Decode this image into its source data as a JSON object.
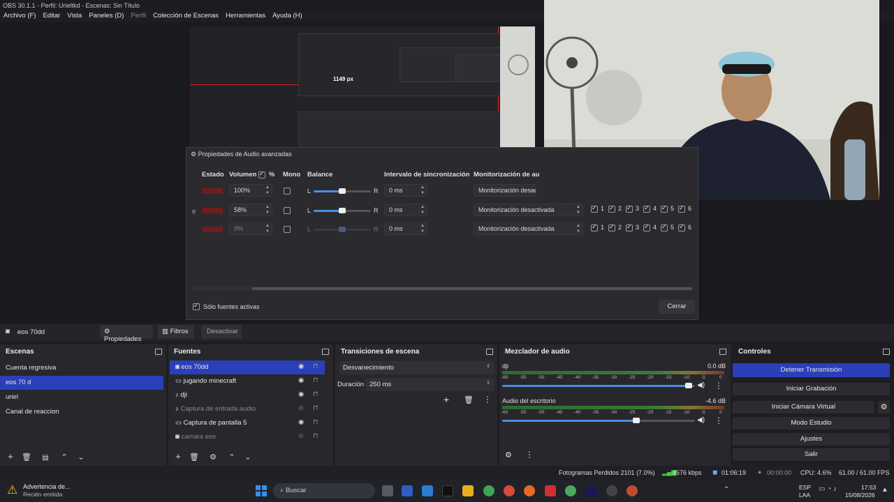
{
  "window": {
    "title": "OBS 30.1.1 - Perfil: Urieltkd - Escenas: Sin Título"
  },
  "menu": [
    "Archivo (F)",
    "Editar",
    "Vista",
    "Paneles (D)",
    "Perfil",
    "Colección de Escenas",
    "Herramientas",
    "Ayuda (H)"
  ],
  "nested_preview": {
    "measure_label": "1149 px"
  },
  "dialog": {
    "title": "Propiedades de Audio avanzadas",
    "headers": {
      "estado": "Estado",
      "volumen": "Volumen",
      "percent": "%",
      "mono": "Mono",
      "balance": "Balance",
      "sync": "Intervalo de sincronización",
      "monitor": "Monitorización de au"
    },
    "rows": [
      {
        "volume": "100%",
        "balance": 0.5,
        "sync": "0 ms",
        "monitor": "Monitorización desac",
        "tracks": []
      },
      {
        "volume": "58%",
        "balance": 0.5,
        "sync": "0 ms",
        "monitor": "Monitorización desactivada",
        "tracks": [
          "1",
          "2",
          "3",
          "4",
          "5",
          "6"
        ]
      },
      {
        "volume": "0%",
        "balance": 0.5,
        "sync": "0 ms",
        "monitor": "Monitorización desactivada",
        "tracks": [
          "1",
          "2",
          "3",
          "4",
          "5",
          "6"
        ]
      }
    ],
    "balance_left": "L",
    "balance_right": "R",
    "only_active": "Sólo fuentes activas",
    "close": "Cerrar"
  },
  "source_bar": {
    "selected": "eos 70dd",
    "properties": "Propiedades",
    "filters": "Filtros",
    "deactivate": "Desactivar"
  },
  "scenes": {
    "title": "Escenas",
    "items": [
      "Cuenta regresiva",
      "eos 70 d",
      "uriel",
      "Canal de reaccion"
    ],
    "selected": 1
  },
  "sources": {
    "title": "Fuentes",
    "items": [
      {
        "name": "eos 70dd",
        "icon": "camera-icon",
        "visible": true
      },
      {
        "name": "jugando minecraft",
        "icon": "monitor-icon",
        "visible": true
      },
      {
        "name": "dji",
        "icon": "mic-icon",
        "visible": true
      },
      {
        "name": "Captura de entrada audio",
        "icon": "mic-icon",
        "visible": false
      },
      {
        "name": "Captura de pantalla 5",
        "icon": "monitor-icon",
        "visible": true
      },
      {
        "name": "camara eos",
        "icon": "camera-icon",
        "visible": false
      }
    ]
  },
  "transitions": {
    "title": "Transiciones de escena",
    "type": "Desvanecimiento",
    "duration_label": "Duración",
    "duration": "250 ms"
  },
  "mixer": {
    "title": "Mezclador de audio",
    "ticks": [
      "-60",
      "-55",
      "-50",
      "-45",
      "-40",
      "-35",
      "-30",
      "-25",
      "-20",
      "-15",
      "-10",
      "-5",
      "0"
    ],
    "channels": [
      {
        "name": "dji",
        "db": "0.0 dB",
        "level": 0.97
      },
      {
        "name": "Audio del escritorio",
        "db": "-4.6 dB",
        "level": 0.7
      }
    ]
  },
  "controls": {
    "title": "Controles",
    "buttons": [
      "Detener Transmisión",
      "Iniciar Grabación",
      "Iniciar Cámara Virtual",
      "Modo Estudio",
      "Ajustes",
      "Salir"
    ]
  },
  "status": {
    "dropped": "Fotogramas Perdidos 2101 (7.0%)",
    "bitrate": "4576 kbps",
    "stream_time": "01:06:19",
    "rec_time": "00:00:00",
    "cpu": "CPU: 4.6%",
    "fps": "61.00 / 61.00 FPS"
  },
  "taskbar": {
    "notif_title": "Advertencia de...",
    "notif_sub": "Recién emitida",
    "search": "Buscar",
    "lang1": "ESP",
    "lang2": "LAA",
    "time": "17:53",
    "date": "15/08/2026"
  },
  "colors": {
    "accent": "#2b3fb8",
    "danger": "#e02020"
  }
}
